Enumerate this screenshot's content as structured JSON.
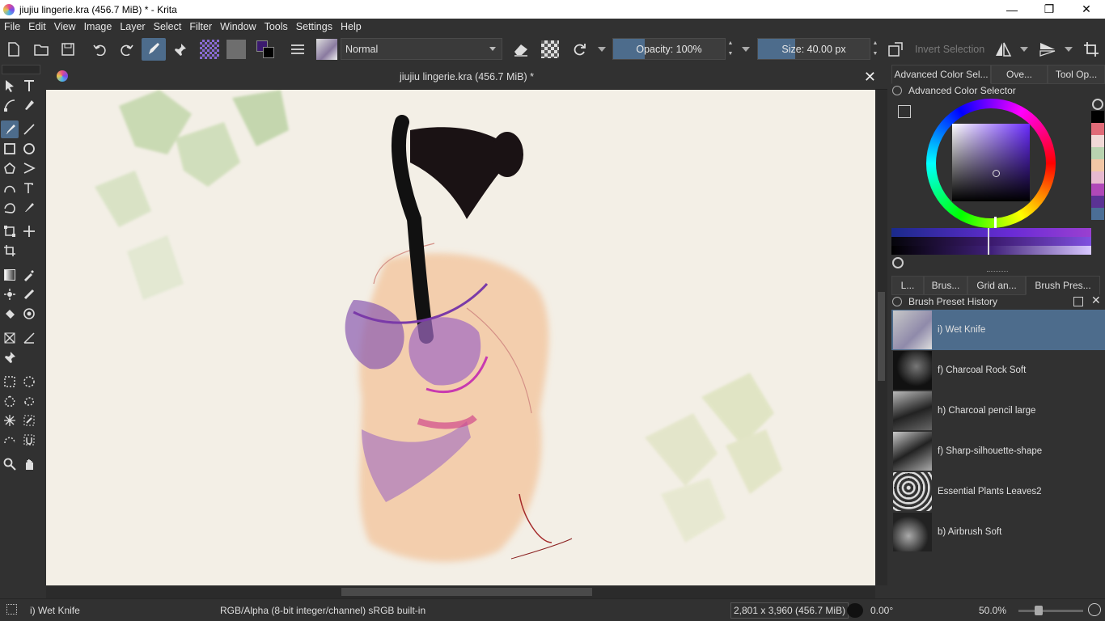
{
  "window": {
    "title": "jiujiu lingerie.kra (456.7 MiB) * - Krita"
  },
  "menu": [
    "File",
    "Edit",
    "View",
    "Image",
    "Layer",
    "Select",
    "Filter",
    "Window",
    "Tools",
    "Settings",
    "Help"
  ],
  "toolbar": {
    "blend_mode": "Normal",
    "opacity_label": "Opacity: 100%",
    "opacity_fraction": 0.28,
    "size_label": "Size: 40.00 px",
    "size_fraction": 0.33,
    "invert_selection": "Invert Selection"
  },
  "document": {
    "tab_title": "jiujiu lingerie.kra (456.7 MiB) *"
  },
  "dock_top": {
    "tabs": [
      "Advanced Color Sel...",
      "Ove...",
      "Tool Op..."
    ],
    "panel_title": "Advanced Color Selector",
    "palette": [
      "#000000",
      "#e06b78",
      "#f1d9d7",
      "#b9d3b0",
      "#f2c7a6",
      "#e7b9cf",
      "#b048b8",
      "#5b3294",
      "#4b6e96"
    ]
  },
  "dock_bottom": {
    "tabs": [
      "L...",
      "Brus...",
      "Grid an...",
      "Brush Pres..."
    ],
    "panel_title": "Brush Preset History",
    "presets": [
      {
        "label": "i) Wet Knife"
      },
      {
        "label": "f) Charcoal Rock Soft"
      },
      {
        "label": "h) Charcoal pencil large"
      },
      {
        "label": "f) Sharp-silhouette-shape"
      },
      {
        "label": "Essential Plants Leaves2"
      },
      {
        "label": "b) Airbrush Soft"
      }
    ]
  },
  "status": {
    "brush": "i) Wet Knife",
    "colorspace": "RGB/Alpha (8-bit integer/channel)  sRGB built-in",
    "dimensions": "2,801 x 3,960 (456.7 MiB)",
    "rotation": "0.00°",
    "zoom": "50.0%"
  },
  "colors": {
    "accent": "#4d6c8c",
    "bg": "#313131",
    "fg_color": "#3b1a6e"
  }
}
